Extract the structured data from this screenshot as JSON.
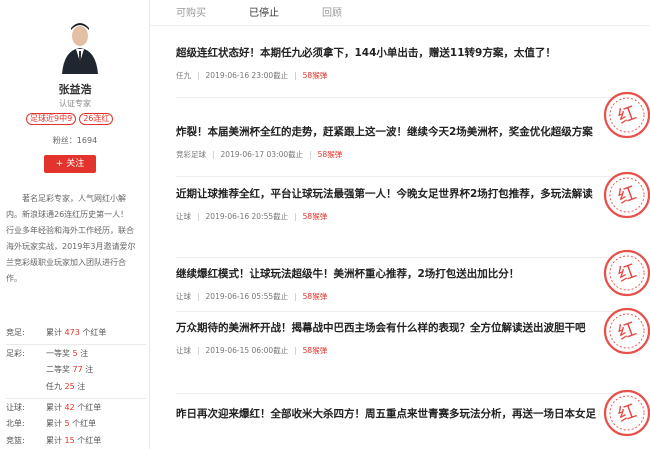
{
  "profile": {
    "name": "张益浩",
    "certification": "认证专家",
    "badges": [
      "足球近9中9",
      "26连红"
    ],
    "fans": "粉丝：1694",
    "follow_label": "+ 关注",
    "bio": "著名足彩专家，人气网红小解内。新浪球通26连红历史第一人！行业多年经验和海外工作经历，联合海外玩家实战，2019年3月邀请爱尔兰竞彩级职业玩家加入团队进行合作。",
    "stats": [
      {
        "category": "竞足:",
        "prefix": "累计 ",
        "num": "473",
        "suffix": " 个红单"
      },
      {
        "category": "足彩:",
        "prefix": "一等奖 ",
        "num": "5",
        "suffix": " 注"
      },
      {
        "category": "",
        "prefix": "二等奖 ",
        "num": "77",
        "suffix": " 注"
      },
      {
        "category": "",
        "prefix": "任九 ",
        "num": "25",
        "suffix": " 注"
      },
      {
        "category": "让球:",
        "prefix": "累计 ",
        "num": "42",
        "suffix": " 个红单"
      },
      {
        "category": "北单:",
        "prefix": "累计 ",
        "num": "5",
        "suffix": " 个红单"
      },
      {
        "category": "竞篮:",
        "prefix": "累计 ",
        "num": "15",
        "suffix": " 个红单"
      }
    ]
  },
  "tabs": [
    "可购买",
    "已停止",
    "回顾"
  ],
  "active_tab": "已停止",
  "articles": [
    {
      "title": "超级连红状态好！本期任九必须拿下，144小单出击，赠送11转9方案，太值了！",
      "type": "任九",
      "time": "2019-06-16 23:00截止",
      "price": "58猴弹",
      "stamp": false
    },
    {
      "title": "炸裂！本届美洲杯全红的走势，赶紧跟上这一波！继续今天2场美洲杯，奖金优化超级方案",
      "type": "竞彩足球",
      "time": "2019-06-17 03:00截止",
      "price": "58猴弹",
      "stamp": true
    },
    {
      "title": "近期让球推荐全红，平台让球玩法最强第一人！今晚女足世界杯2场打包推荐，多玩法解读",
      "type": "让球",
      "time": "2019-06-16 20:55截止",
      "price": "58猴弹",
      "stamp": true
    },
    {
      "title": "继续爆红模式！让球玩法超级牛！美洲杯重心推荐，2场打包送出加比分！",
      "type": "让球",
      "time": "2019-06-16 05:55截止",
      "price": "58猴弹",
      "stamp": true
    },
    {
      "title": "万众期待的美洲杯开战！揭幕战中巴西主场会有什么样的表现？全方位解读送出波胆干吧",
      "type": "让球",
      "time": "2019-06-15 06:00截止",
      "price": "58猴弹",
      "stamp": true
    },
    {
      "title": "昨日再次迎来爆红！全部收米大杀四方！周五重点来世青赛多玩法分析，再送一场日本女足",
      "type": "",
      "time": "",
      "price": "",
      "stamp": true
    }
  ],
  "stamp_text": "红",
  "colors": {
    "accent": "#e2342c"
  }
}
